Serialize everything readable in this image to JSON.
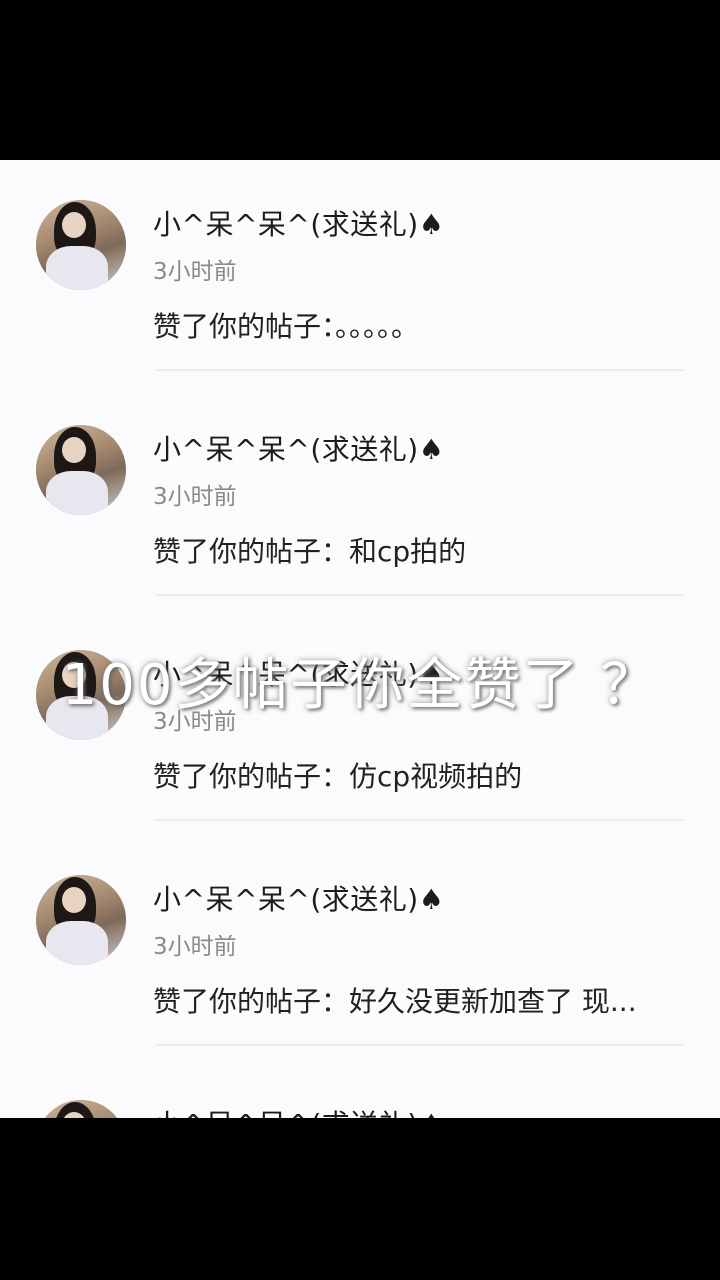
{
  "notifications": [
    {
      "name": "小^呆^呆^(求送礼)♠",
      "time": "3小时前",
      "text": "赞了你的帖子：。。。。。"
    },
    {
      "name": "小^呆^呆^(求送礼)♠",
      "time": "3小时前",
      "text": "赞了你的帖子：和cp拍的"
    },
    {
      "name": "小^呆^呆^(求送礼)♠",
      "time": "3小时前",
      "text": "赞了你的帖子：仿cp视频拍的"
    },
    {
      "name": "小^呆^呆^(求送礼)♠",
      "time": "3小时前",
      "text": "赞了你的帖子：好久没更新加查了 现..."
    },
    {
      "name": "小^呆^呆^(求送礼)♠"
    }
  ],
  "overlay": {
    "caption": "100多帖子你全赞了 ？"
  },
  "colors": {
    "background": "#fbfbfd",
    "frame": "#000000",
    "name": "#1c1c1c",
    "time": "#8a8a8a"
  }
}
